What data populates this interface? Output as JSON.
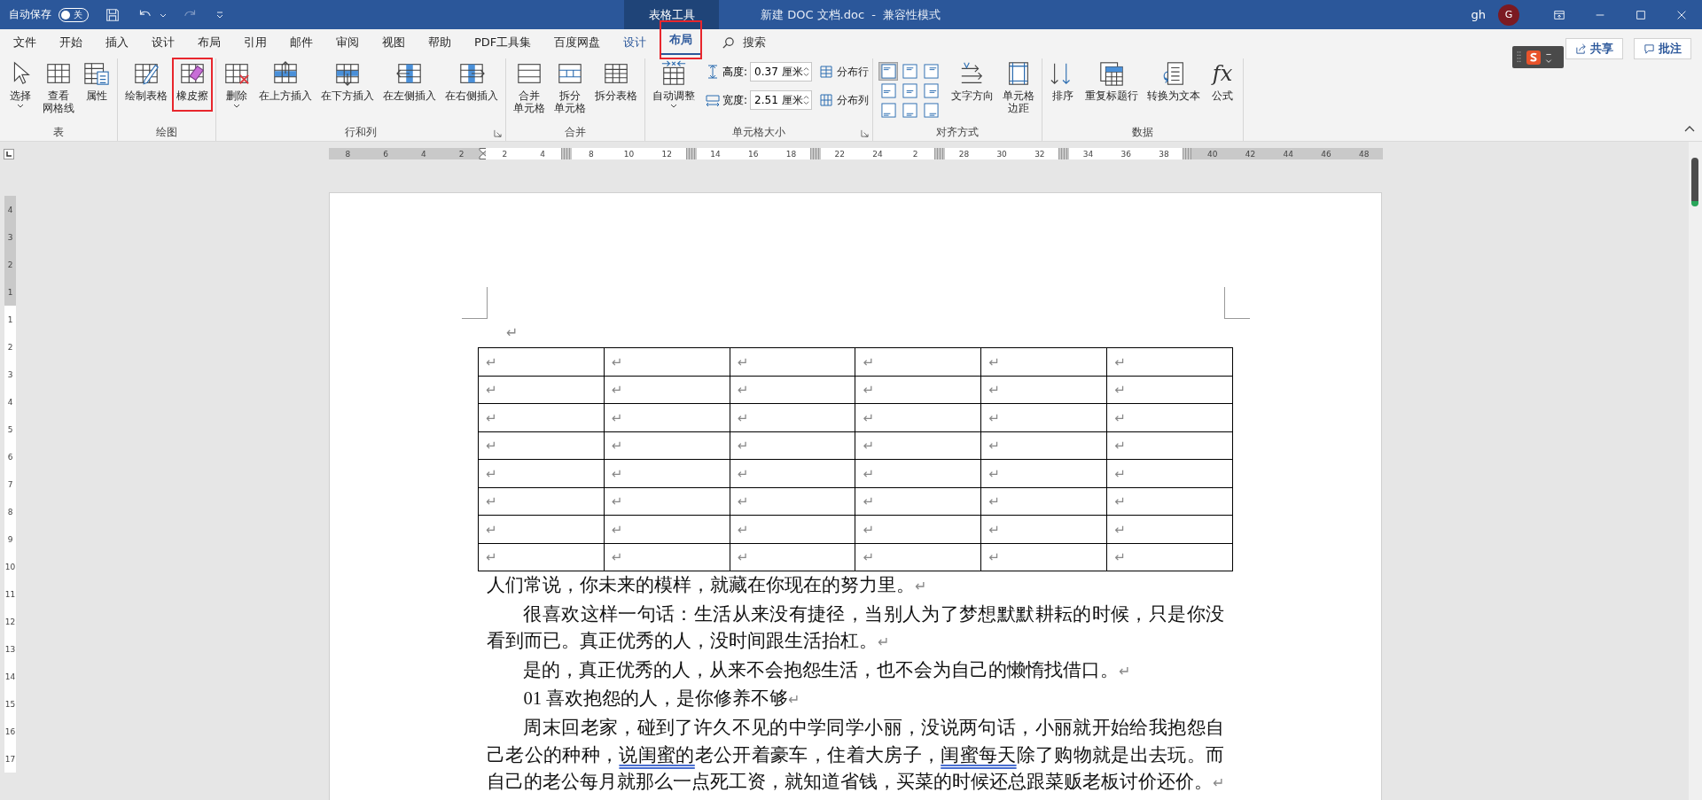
{
  "title_bar": {
    "autosave": {
      "label": "自动保存",
      "on": false,
      "state": "关"
    },
    "context_header": "表格工具",
    "document_title": "新建 DOC 文档.doc  -  兼容性模式",
    "user": "gh",
    "avatar": "G"
  },
  "tabs": [
    {
      "label": "文件",
      "selected": false,
      "contextual": false,
      "highlighted": false
    },
    {
      "label": "开始",
      "selected": false,
      "contextual": false,
      "highlighted": false
    },
    {
      "label": "插入",
      "selected": false,
      "contextual": false,
      "highlighted": false
    },
    {
      "label": "设计",
      "selected": false,
      "contextual": false,
      "highlighted": false
    },
    {
      "label": "布局",
      "selected": false,
      "contextual": false,
      "highlighted": false
    },
    {
      "label": "引用",
      "selected": false,
      "contextual": false,
      "highlighted": false
    },
    {
      "label": "邮件",
      "selected": false,
      "contextual": false,
      "highlighted": false
    },
    {
      "label": "审阅",
      "selected": false,
      "contextual": false,
      "highlighted": false
    },
    {
      "label": "视图",
      "selected": false,
      "contextual": false,
      "highlighted": false
    },
    {
      "label": "帮助",
      "selected": false,
      "contextual": false,
      "highlighted": false
    },
    {
      "label": "PDF工具集",
      "selected": false,
      "contextual": false,
      "highlighted": false
    },
    {
      "label": "百度网盘",
      "selected": false,
      "contextual": false,
      "highlighted": false
    },
    {
      "label": "设计",
      "selected": false,
      "contextual": true,
      "highlighted": false
    },
    {
      "label": "布局",
      "selected": true,
      "contextual": true,
      "highlighted": true
    }
  ],
  "search": {
    "label": "搜索"
  },
  "share_button": "共享",
  "comments_button": "批注",
  "ribbon": {
    "groups": [
      {
        "label": "表",
        "items": [
          {
            "kind": "large",
            "label": "选择",
            "caret": true,
            "highlighted": false
          },
          {
            "kind": "large",
            "lines": [
              "查看",
              "网格线"
            ],
            "caret": false,
            "highlighted": false
          },
          {
            "kind": "large",
            "label": "属性",
            "caret": false,
            "highlighted": false
          }
        ]
      },
      {
        "label": "绘图",
        "items": [
          {
            "kind": "large",
            "label": "绘制表格",
            "caret": false,
            "highlighted": false
          },
          {
            "kind": "large",
            "label": "橡皮擦",
            "caret": false,
            "highlighted": true
          }
        ]
      },
      {
        "label": "行和列",
        "launcher": true,
        "items": [
          {
            "kind": "large",
            "label": "删除",
            "caret": true,
            "highlighted": false
          },
          {
            "kind": "large",
            "label": "在上方插入",
            "caret": false,
            "highlighted": false
          },
          {
            "kind": "large",
            "label": "在下方插入",
            "caret": false,
            "highlighted": false
          },
          {
            "kind": "large",
            "label": "在左侧插入",
            "caret": false,
            "highlighted": false
          },
          {
            "kind": "large",
            "label": "在右侧插入",
            "caret": false,
            "highlighted": false
          }
        ]
      },
      {
        "label": "合并",
        "items": [
          {
            "kind": "large",
            "lines": [
              "合并",
              "单元格"
            ],
            "caret": false,
            "highlighted": false
          },
          {
            "kind": "large",
            "lines": [
              "拆分",
              "单元格"
            ],
            "caret": false,
            "highlighted": false
          },
          {
            "kind": "large",
            "label": "拆分表格",
            "caret": false,
            "highlighted": false
          }
        ]
      },
      {
        "label": "单元格大小",
        "launcher": true,
        "items": [
          {
            "kind": "large",
            "label": "自动调整",
            "caret": true,
            "highlighted": false
          },
          {
            "kind": "field",
            "label": "高度:",
            "value": "0.37 厘米"
          },
          {
            "kind": "field",
            "label": "宽度:",
            "value": "2.51 厘米"
          },
          {
            "kind": "small",
            "label": "分布行"
          },
          {
            "kind": "small",
            "label": "分布列"
          }
        ]
      },
      {
        "label": "对齐方式",
        "items": [
          {
            "kind": "align-grid",
            "cells": [
              {
                "selected": true
              },
              {
                "selected": false
              },
              {
                "selected": false
              },
              {
                "selected": false
              },
              {
                "selected": false
              },
              {
                "selected": false
              },
              {
                "selected": false
              },
              {
                "selected": false
              },
              {
                "selected": false
              }
            ]
          },
          {
            "kind": "large",
            "label": "文字方向",
            "caret": false,
            "highlighted": false
          },
          {
            "kind": "large",
            "lines": [
              "单元格",
              "边距"
            ],
            "caret": false,
            "highlighted": false
          }
        ]
      },
      {
        "label": "数据",
        "items": [
          {
            "kind": "large",
            "label": "排序",
            "caret": false,
            "highlighted": false
          },
          {
            "kind": "large",
            "label": "重复标题行",
            "caret": false,
            "highlighted": false
          },
          {
            "kind": "large",
            "label": "转换为文本",
            "caret": false,
            "highlighted": false
          },
          {
            "kind": "large",
            "label": "公式",
            "glyph": "fx",
            "caret": false,
            "highlighted": false
          }
        ]
      }
    ]
  },
  "ruler": {
    "items": [
      {
        "kind": "number",
        "text": "8",
        "margin": true
      },
      {
        "kind": "number",
        "text": "6",
        "margin": true
      },
      {
        "kind": "number",
        "text": "4",
        "margin": true
      },
      {
        "kind": "number",
        "text": "2",
        "margin": true
      },
      {
        "kind": "indent-marker"
      },
      {
        "kind": "number",
        "text": "2",
        "margin": false
      },
      {
        "kind": "number",
        "text": "4",
        "margin": false
      },
      {
        "kind": "column-marker"
      },
      {
        "kind": "number",
        "text": "8",
        "margin": false
      },
      {
        "kind": "number",
        "text": "10",
        "margin": false
      },
      {
        "kind": "number",
        "text": "12",
        "margin": false
      },
      {
        "kind": "column-marker"
      },
      {
        "kind": "number",
        "text": "14",
        "margin": false
      },
      {
        "kind": "number",
        "text": "16",
        "margin": false
      },
      {
        "kind": "number",
        "text": "18",
        "margin": false
      },
      {
        "kind": "column-marker"
      },
      {
        "kind": "number",
        "text": "22",
        "margin": false
      },
      {
        "kind": "number",
        "text": "24",
        "margin": false
      },
      {
        "kind": "number",
        "text": "2",
        "margin": false
      },
      {
        "kind": "column-marker"
      },
      {
        "kind": "number",
        "text": "28",
        "margin": false
      },
      {
        "kind": "number",
        "text": "30",
        "margin": false
      },
      {
        "kind": "number",
        "text": "32",
        "margin": false
      },
      {
        "kind": "column-marker"
      },
      {
        "kind": "number",
        "text": "34",
        "margin": false
      },
      {
        "kind": "number",
        "text": "36",
        "margin": false
      },
      {
        "kind": "number",
        "text": "38",
        "margin": false
      },
      {
        "kind": "column-marker"
      },
      {
        "kind": "number",
        "text": "40",
        "margin": true
      },
      {
        "kind": "number",
        "text": "42",
        "margin": true
      },
      {
        "kind": "number",
        "text": "44",
        "margin": true
      },
      {
        "kind": "number",
        "text": "46",
        "margin": true
      },
      {
        "kind": "number",
        "text": "48",
        "margin": true
      }
    ]
  },
  "vertical_ruler": {
    "labels": [
      {
        "text": "4",
        "margin": true
      },
      {
        "text": "3",
        "margin": true
      },
      {
        "text": "2",
        "margin": true
      },
      {
        "text": "1",
        "margin": true
      },
      {
        "text": "1",
        "margin": false
      },
      {
        "text": "2",
        "margin": false
      },
      {
        "text": "3",
        "margin": false
      },
      {
        "text": "4",
        "margin": false
      },
      {
        "text": "5",
        "margin": false
      },
      {
        "text": "6",
        "margin": false
      },
      {
        "text": "7",
        "margin": false
      },
      {
        "text": "8",
        "margin": false
      },
      {
        "text": "9",
        "margin": false
      },
      {
        "text": "10",
        "margin": false
      },
      {
        "text": "11",
        "margin": false
      },
      {
        "text": "12",
        "margin": false
      },
      {
        "text": "13",
        "margin": false
      },
      {
        "text": "14",
        "margin": false
      },
      {
        "text": "15",
        "margin": false
      },
      {
        "text": "16",
        "margin": false
      },
      {
        "text": "17",
        "margin": false
      }
    ]
  },
  "document": {
    "leading_mark": "↵",
    "table": {
      "rows": [
        {
          "cells": [
            "↵",
            "↵",
            "↵",
            "↵",
            "↵",
            "↵"
          ]
        },
        {
          "cells": [
            "↵",
            "↵",
            "↵",
            "↵",
            "↵",
            "↵"
          ]
        },
        {
          "cells": [
            "↵",
            "↵",
            "↵",
            "↵",
            "↵",
            "↵"
          ]
        },
        {
          "cells": [
            "↵",
            "↵",
            "↵",
            "↵",
            "↵",
            "↵"
          ]
        },
        {
          "cells": [
            "↵",
            "↵",
            "↵",
            "↵",
            "↵",
            "↵"
          ]
        },
        {
          "cells": [
            "↵",
            "↵",
            "↵",
            "↵",
            "↵",
            "↵"
          ]
        },
        {
          "cells": [
            "↵",
            "↵",
            "↵",
            "↵",
            "↵",
            "↵"
          ]
        },
        {
          "cells": [
            "↵",
            "↵",
            "↵",
            "↵",
            "↵",
            "↵"
          ]
        }
      ]
    },
    "paragraphs": [
      {
        "indent": false,
        "mark": "↵",
        "segments": [
          {
            "text": "人们常说，你未来的模样，就藏在你现在的努力里。",
            "underlined": false
          }
        ]
      },
      {
        "indent": true,
        "mark": "↵",
        "segments": [
          {
            "text": "很喜欢这样一句话：生活从来没有捷径，当别人为了梦想默默耕耘的时候，只是你没看到而已。真正优秀的人，没时间跟生活抬杠。",
            "underlined": false
          }
        ]
      },
      {
        "indent": true,
        "mark": "↵",
        "segments": [
          {
            "text": "是的，真正优秀的人，从来不会抱怨生活，也不会为自己的懒惰找借口。",
            "underlined": false
          }
        ]
      },
      {
        "indent": true,
        "mark": "↵",
        "segments": [
          {
            "text": "01  喜欢抱怨的人，是你修养不够",
            "underlined": false
          }
        ]
      },
      {
        "indent": true,
        "mark": "↵",
        "segments": [
          {
            "text": "周末回老家，碰到了许久不见的中学同学小丽，没说两句话，小丽就开始给我抱怨自己老公的种种，",
            "underlined": false
          },
          {
            "text": "说闺蜜的",
            "underlined": true
          },
          {
            "text": "老公开着豪车，住着大房子，",
            "underlined": false
          },
          {
            "text": "闺蜜每天",
            "underlined": true
          },
          {
            "text": "除了购物就是出去玩。而自己的老公每月就那么一点死工资，就知道省钱，买菜的时候还总跟菜贩老板讨价还价。",
            "underlined": false
          }
        ]
      }
    ]
  }
}
